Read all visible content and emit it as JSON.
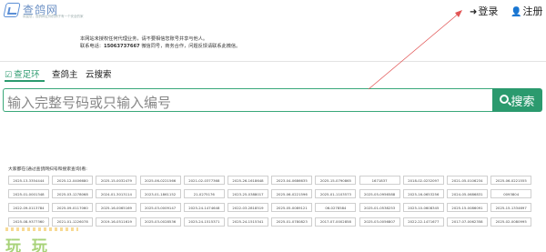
{
  "header": {
    "logo_name": "查鸽网",
    "logo_slogan": "欢迎您，查鸽网让你的鸽子有一个安全的家",
    "login_label": "登录",
    "register_label": "注册"
  },
  "notice": {
    "line1": "本网站未授权任何代理业务，请不要相信您账号并享与他人。",
    "line2_prefix": "联系电话：",
    "phone": "15063737667",
    "line2_suffix": " 微信同号，商务合作，问题反馈请联系此微信。"
  },
  "tabs": [
    {
      "label": "查足环"
    },
    {
      "label": "查鸽主"
    },
    {
      "label": "云搜索"
    }
  ],
  "search": {
    "placeholder": "输入完整号码或只输入编号",
    "button_label": "搜索"
  },
  "recent": {
    "label": "大家都在(通过查鸽网扫号和搜索查询)看:",
    "rows": [
      [
        "2025-13-3354444",
        "2025-12-0406680",
        "2025-15-0032479",
        "2025-06-0221566",
        "2021-02-0377368",
        "2025-26-1618648",
        "2023-04-0686635",
        "2025-15-0790865",
        "1671837",
        "2018-02-0232097",
        "2021-05-0106234",
        "2025-06-0221555"
      ],
      [
        "2025-01-0001348",
        "2025-03-1278068",
        "2024-01-3013114",
        "2023-01-1861152",
        "21-0275176",
        "2023-25-0388017",
        "2025-06-0221596",
        "2025-01-1103573",
        "2025-05-0956588",
        "2025-16-0653256",
        "2024-05-0686831",
        "0093804"
      ],
      [
        "2022-09-0113784",
        "2025-09-0117060",
        "2025-16-0065169",
        "2025-03-0009147",
        "2025-24-1474648",
        "2022-03-2818519",
        "2025-05-0089121",
        "06-0278584",
        "2025-01-0538253",
        "2025-10-0608345",
        "2025-15-0086091",
        "2025-15-1334697"
      ],
      [
        "2025-08-9377360",
        "2021-01-1226078",
        "2019-16-0511619",
        "2025-03-0028536",
        "2025-24-1515371",
        "2025-24-1515341",
        "2025-01-0780823",
        "2017-07-0002858",
        "2025-03-0056807",
        "2022-22-1471677",
        "2017-07-0062358",
        "2025-02-0080995"
      ]
    ]
  },
  "watermark": "玩 玩",
  "colors": {
    "accent": "#2b9a6e",
    "arrow": "#e25555"
  }
}
